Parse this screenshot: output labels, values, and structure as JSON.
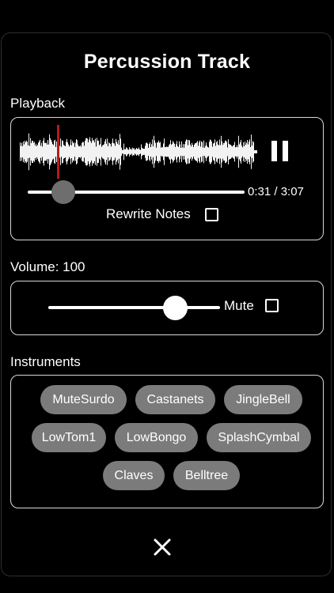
{
  "title": "Percussion Track",
  "playback": {
    "section_label": "Playback",
    "position": "0:31",
    "duration": "3:07",
    "time_display": "0:31 / 3:07",
    "progress_fraction": 0.166,
    "state": "playing",
    "rewrite_notes_label": "Rewrite Notes",
    "rewrite_notes_checked": false
  },
  "volume": {
    "section_label": "Volume: 100",
    "value": 100,
    "mute_label": "Mute",
    "mute_checked": false
  },
  "instruments": {
    "section_label": "Instruments",
    "items": [
      "MuteSurdo",
      "Castanets",
      "JingleBell",
      "LowTom1",
      "LowBongo",
      "SplashCymbal",
      "Claves",
      "Belltree"
    ]
  },
  "colors": {
    "background": "#000000",
    "border": "#d8d8d8",
    "chip": "#7b7b7b",
    "playhead": "#b31b1b",
    "thumb_playback": "#6e6e6e",
    "thumb_volume": "#ffffff"
  },
  "icons": {
    "pause": "pause-icon",
    "close": "close-icon"
  }
}
